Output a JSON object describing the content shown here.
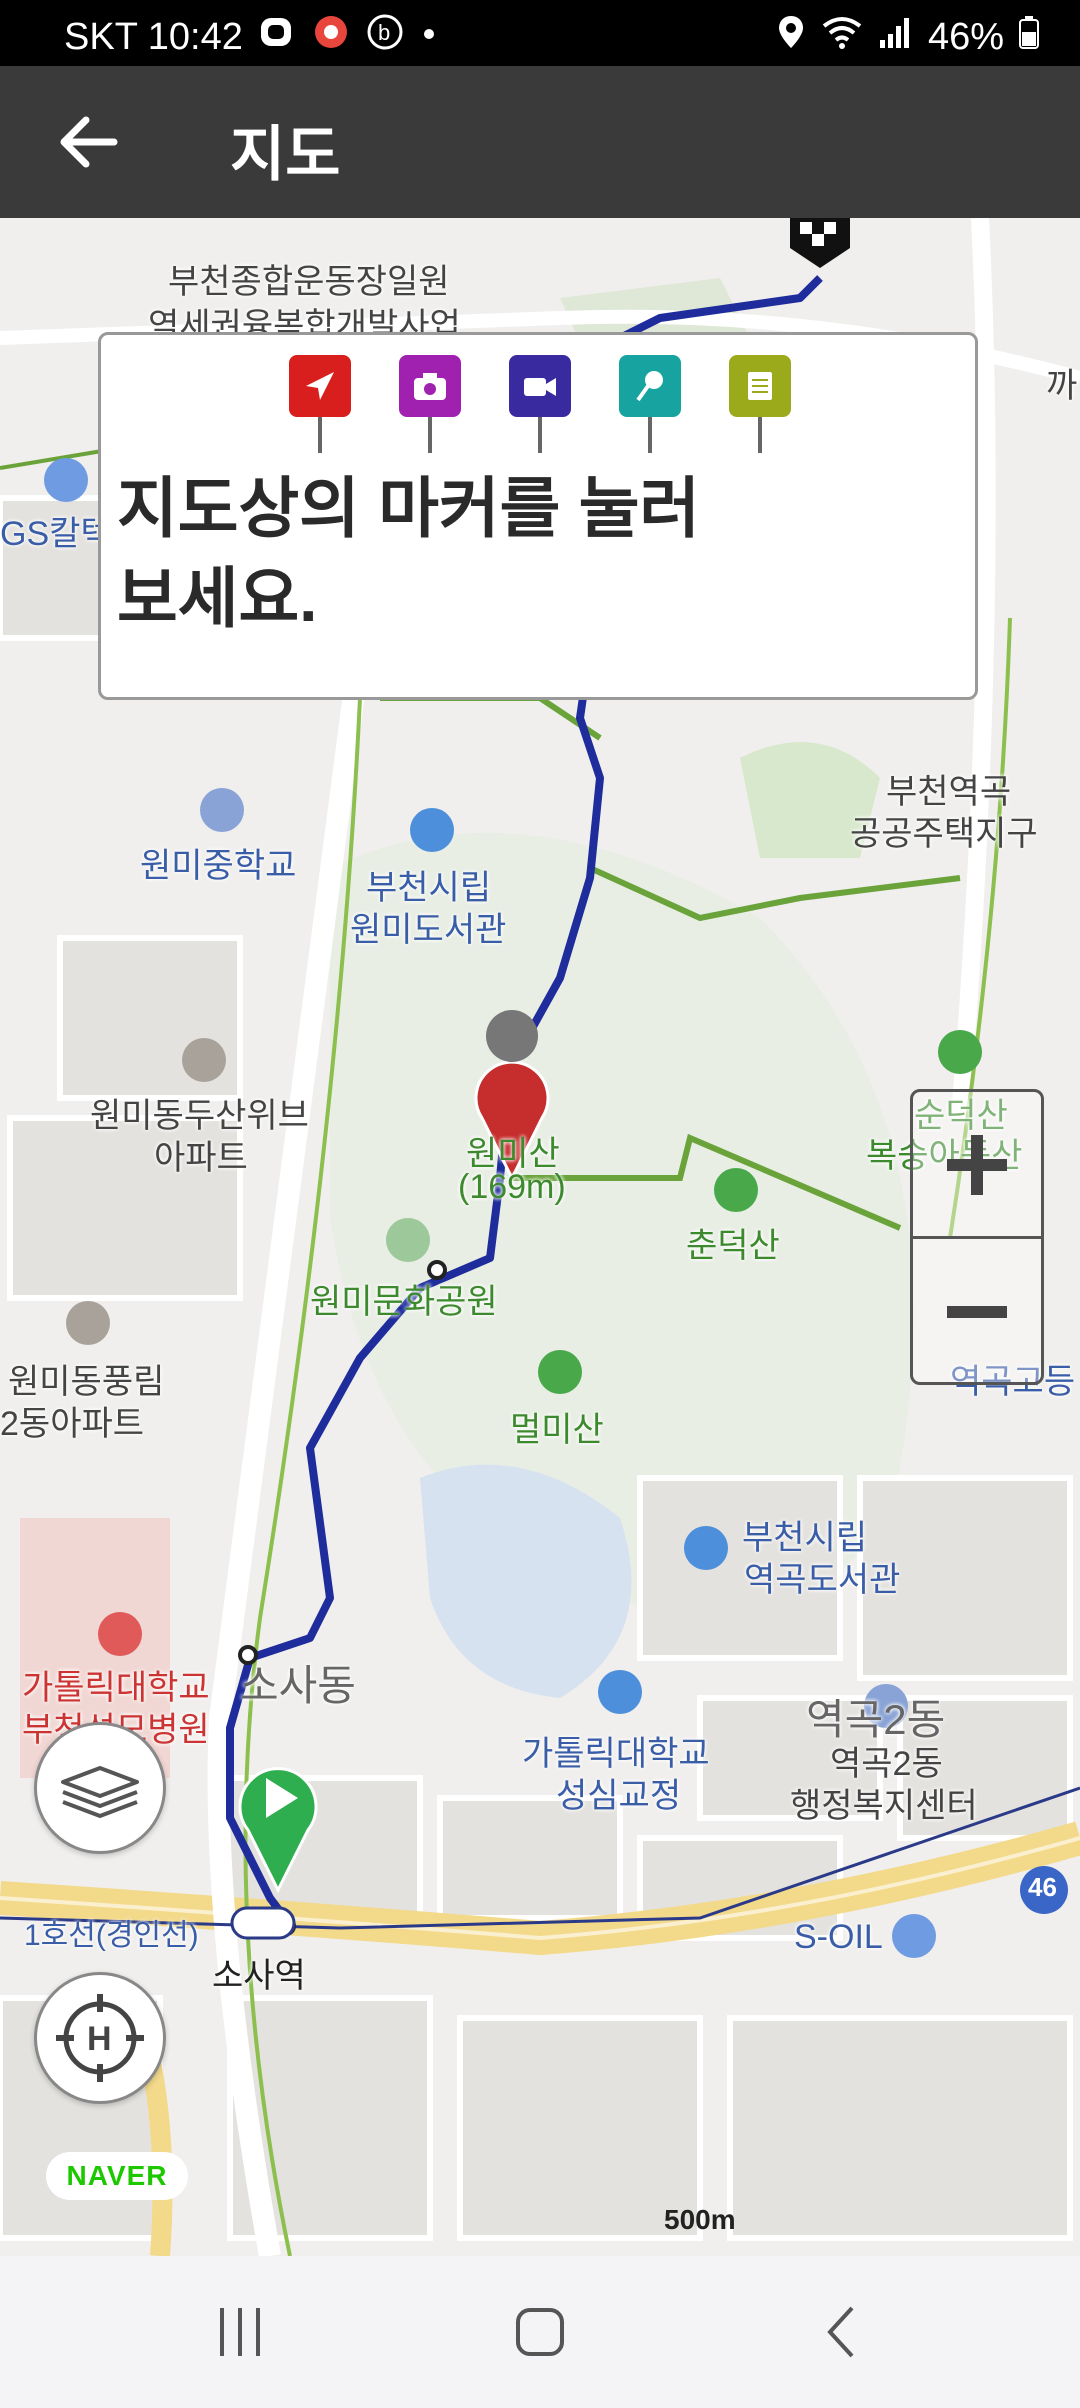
{
  "status_bar": {
    "carrier_time": "SKT 10:42",
    "battery": "46%"
  },
  "app_bar": {
    "title": "지도"
  },
  "instruction": {
    "line1": "지도상의 마커를 눌러",
    "line2": "보세요.",
    "markers": [
      {
        "icon": "location-arrow-icon",
        "color": "#d91e1e"
      },
      {
        "icon": "camera-icon",
        "color": "#a020b0"
      },
      {
        "icon": "video-icon",
        "color": "#3a2aa0"
      },
      {
        "icon": "microphone-icon",
        "color": "#17a3a0"
      },
      {
        "icon": "memo-icon",
        "color": "#9aaa1a"
      }
    ]
  },
  "map": {
    "labels": {
      "sports_park": "부천종합운동장일원",
      "dev_project": "역세권융복합개발사업",
      "gs_caltex": "GS칼텍",
      "kka": "까",
      "wonmi_middle": "원미중학교",
      "bucheon_library": "부천시립",
      "wonmi_library": "원미도서관",
      "station_district1": "부천역곡",
      "station_district2": "공공주택지구",
      "wonmi_doosan1": "원미동두산위브",
      "wonmi_doosan2": "아파트",
      "wonmisan": "원미산",
      "wonmisan_height": "(169m)",
      "chundeoksan": "춘덕산",
      "chundeok_top": "순덕산",
      "bokseonga": "복숭아동산",
      "wonmi_culture": "원미문화공원",
      "wonmi_pungrim1": "원미동풍림",
      "wonmi_pungrim2": "2동아파트",
      "meolmisan": "멀미산",
      "yeokgok_library1": "부천시립",
      "yeokgok_library2": "역곡도서관",
      "yeokgok_highschool": "역곡고등",
      "catholic_univ1": "가톨릭대학교",
      "catholic_univ2": "부천성모병원",
      "sosa_dong": "소사동",
      "catholic_campus1": "가톨릭대학교",
      "catholic_campus2": "성심교정",
      "yeokgok2dong": "역곡2동",
      "yeokgok2_center1": "역곡2동",
      "yeokgok2_center2": "행정복지센터",
      "line1": "1호선(경인선)",
      "sosa_station": "소사역",
      "soil": "S-OIL",
      "route46": "46"
    },
    "attribution": "NAVER",
    "scale_label": "500m"
  }
}
